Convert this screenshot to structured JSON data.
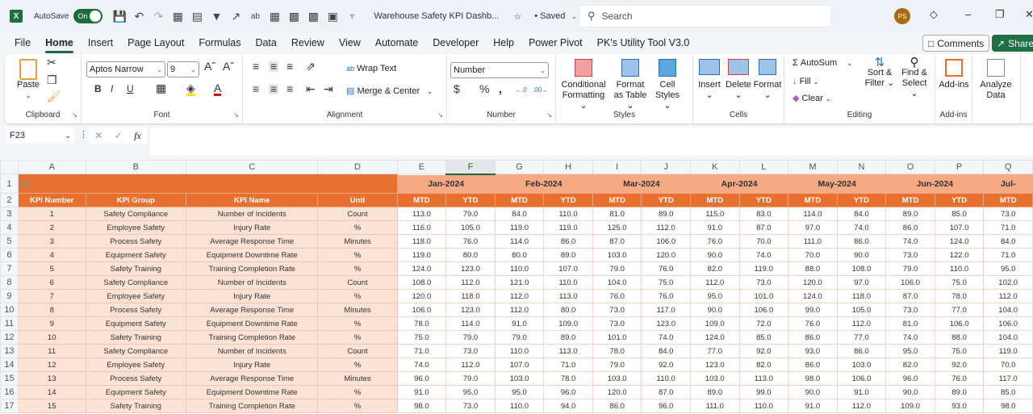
{
  "titlebar": {
    "autosave_label": "AutoSave",
    "autosave_state": "On",
    "doc_title": "Warehouse Safety KPI Dashb...",
    "saved_status": "• Saved",
    "search_placeholder": "Search",
    "avatar_initials": "PS"
  },
  "menu": {
    "tabs": [
      "File",
      "Home",
      "Insert",
      "Page Layout",
      "Formulas",
      "Data",
      "Review",
      "View",
      "Automate",
      "Developer",
      "Help",
      "Power Pivot",
      "PK's Utility Tool V3.0"
    ],
    "active_tab": "Home",
    "comments_label": "Comments",
    "share_label": "Share"
  },
  "ribbon": {
    "clipboard": {
      "label": "Clipboard",
      "paste": "Paste"
    },
    "font": {
      "label": "Font",
      "font_name": "Aptos Narrow",
      "font_size": "9"
    },
    "alignment": {
      "label": "Alignment",
      "wrap_text": "Wrap Text",
      "merge_center": "Merge & Center"
    },
    "number": {
      "label": "Number",
      "format": "Number"
    },
    "styles": {
      "label": "Styles",
      "conditional_formatting": "Conditional Formatting",
      "format_as_table": "Format as Table",
      "cell_styles": "Cell Styles"
    },
    "cells": {
      "label": "Cells",
      "insert": "Insert",
      "delete": "Delete",
      "format": "Format"
    },
    "editing": {
      "label": "Editing",
      "autosum": "AutoSum",
      "fill": "Fill",
      "clear": "Clear",
      "sort_filter": "Sort & Filter",
      "find_select": "Find & Select"
    },
    "addins": {
      "label": "Add-ins",
      "addins": "Add-ins"
    },
    "analyze": {
      "analyze_data": "Analyze Data"
    }
  },
  "formula_bar": {
    "name_box": "F23",
    "formula": ""
  },
  "sheet": {
    "columns": [
      "A",
      "B",
      "C",
      "D",
      "E",
      "F",
      "G",
      "H",
      "I",
      "J",
      "K",
      "L",
      "M",
      "N",
      "O",
      "P",
      "Q"
    ],
    "selected_column": "F",
    "row_numbers": [
      "1",
      "2",
      "3",
      "4",
      "5",
      "6",
      "7",
      "8",
      "9",
      "10",
      "11",
      "12",
      "13",
      "14",
      "15",
      "16",
      "17"
    ],
    "headers": [
      "KPI Number",
      "KPI Group",
      "KPI Name",
      "Unit"
    ],
    "months": [
      "Jan-2024",
      "Feb-2024",
      "Mar-2024",
      "Apr-2024",
      "May-2024",
      "Jun-2024",
      "Jul-"
    ],
    "sub_headers": [
      "MTD",
      "YTD",
      "MTD",
      "YTD",
      "MTD",
      "YTD",
      "MTD",
      "YTD",
      "MTD",
      "YTD",
      "MTD",
      "YTD",
      "MTD"
    ],
    "rows": [
      {
        "num": "1",
        "group": "Safety Compliance",
        "name": "Number of Incidents",
        "unit": "Count",
        "values": [
          "113.0",
          "79.0",
          "84.0",
          "110.0",
          "81.0",
          "89.0",
          "115.0",
          "83.0",
          "114.0",
          "84.0",
          "89.0",
          "85.0",
          "73.0"
        ]
      },
      {
        "num": "2",
        "group": "Employee Safety",
        "name": "Injury Rate",
        "unit": "%",
        "values": [
          "116.0",
          "105.0",
          "119.0",
          "119.0",
          "125.0",
          "112.0",
          "91.0",
          "87.0",
          "97.0",
          "74.0",
          "86.0",
          "107.0",
          "71.0"
        ]
      },
      {
        "num": "3",
        "group": "Process Safety",
        "name": "Average Response Time",
        "unit": "Minutes",
        "values": [
          "118.0",
          "76.0",
          "114.0",
          "86.0",
          "87.0",
          "106.0",
          "76.0",
          "70.0",
          "111.0",
          "86.0",
          "74.0",
          "124.0",
          "84.0"
        ]
      },
      {
        "num": "4",
        "group": "Equipment Safety",
        "name": "Equipment Downtime Rate",
        "unit": "%",
        "values": [
          "119.0",
          "80.0",
          "80.0",
          "89.0",
          "103.0",
          "120.0",
          "90.0",
          "74.0",
          "70.0",
          "90.0",
          "73.0",
          "122.0",
          "71.0"
        ]
      },
      {
        "num": "5",
        "group": "Safety Training",
        "name": "Training Completion Rate",
        "unit": "%",
        "values": [
          "124.0",
          "123.0",
          "110.0",
          "107.0",
          "79.0",
          "76.0",
          "82.0",
          "119.0",
          "88.0",
          "108.0",
          "79.0",
          "110.0",
          "95.0"
        ]
      },
      {
        "num": "6",
        "group": "Safety Compliance",
        "name": "Number of Incidents",
        "unit": "Count",
        "values": [
          "108.0",
          "112.0",
          "121.0",
          "110.0",
          "104.0",
          "75.0",
          "112.0",
          "73.0",
          "120.0",
          "97.0",
          "106.0",
          "75.0",
          "102.0"
        ]
      },
      {
        "num": "7",
        "group": "Employee Safety",
        "name": "Injury Rate",
        "unit": "%",
        "values": [
          "120.0",
          "118.0",
          "112.0",
          "113.0",
          "76.0",
          "76.0",
          "95.0",
          "101.0",
          "124.0",
          "118.0",
          "87.0",
          "78.0",
          "112.0"
        ]
      },
      {
        "num": "8",
        "group": "Process Safety",
        "name": "Average Response Time",
        "unit": "Minutes",
        "values": [
          "106.0",
          "123.0",
          "112.0",
          "80.0",
          "73.0",
          "117.0",
          "90.0",
          "106.0",
          "99.0",
          "105.0",
          "73.0",
          "77.0",
          "104.0"
        ]
      },
      {
        "num": "9",
        "group": "Equipment Safety",
        "name": "Equipment Downtime Rate",
        "unit": "%",
        "values": [
          "78.0",
          "114.0",
          "91.0",
          "109.0",
          "73.0",
          "123.0",
          "109.0",
          "72.0",
          "76.0",
          "112.0",
          "81.0",
          "106.0",
          "106.0"
        ]
      },
      {
        "num": "10",
        "group": "Safety Training",
        "name": "Training Completion Rate",
        "unit": "%",
        "values": [
          "75.0",
          "79.0",
          "79.0",
          "89.0",
          "101.0",
          "74.0",
          "124.0",
          "85.0",
          "86.0",
          "77.0",
          "74.0",
          "88.0",
          "104.0"
        ]
      },
      {
        "num": "11",
        "group": "Safety Compliance",
        "name": "Number of Incidents",
        "unit": "Count",
        "values": [
          "71.0",
          "73.0",
          "110.0",
          "113.0",
          "78.0",
          "84.0",
          "77.0",
          "92.0",
          "93.0",
          "86.0",
          "95.0",
          "75.0",
          "119.0"
        ]
      },
      {
        "num": "12",
        "group": "Employee Safety",
        "name": "Injury Rate",
        "unit": "%",
        "values": [
          "74.0",
          "112.0",
          "107.0",
          "71.0",
          "79.0",
          "92.0",
          "123.0",
          "82.0",
          "86.0",
          "103.0",
          "82.0",
          "92.0",
          "70.0"
        ]
      },
      {
        "num": "13",
        "group": "Process Safety",
        "name": "Average Response Time",
        "unit": "Minutes",
        "values": [
          "96.0",
          "79.0",
          "103.0",
          "78.0",
          "103.0",
          "110.0",
          "103.0",
          "113.0",
          "98.0",
          "106.0",
          "96.0",
          "76.0",
          "117.0"
        ]
      },
      {
        "num": "14",
        "group": "Equipment Safety",
        "name": "Equipment Downtime Rate",
        "unit": "%",
        "values": [
          "91.0",
          "95.0",
          "95.0",
          "96.0",
          "120.0",
          "87.0",
          "89.0",
          "99.0",
          "90.0",
          "91.0",
          "90.0",
          "89.0",
          "85.0"
        ]
      },
      {
        "num": "15",
        "group": "Safety Training",
        "name": "Training Completion Rate",
        "unit": "%",
        "values": [
          "98.0",
          "73.0",
          "110.0",
          "94.0",
          "86.0",
          "96.0",
          "111.0",
          "110.0",
          "91.0",
          "112.0",
          "109.0",
          "93.0",
          "98.0"
        ]
      }
    ]
  }
}
